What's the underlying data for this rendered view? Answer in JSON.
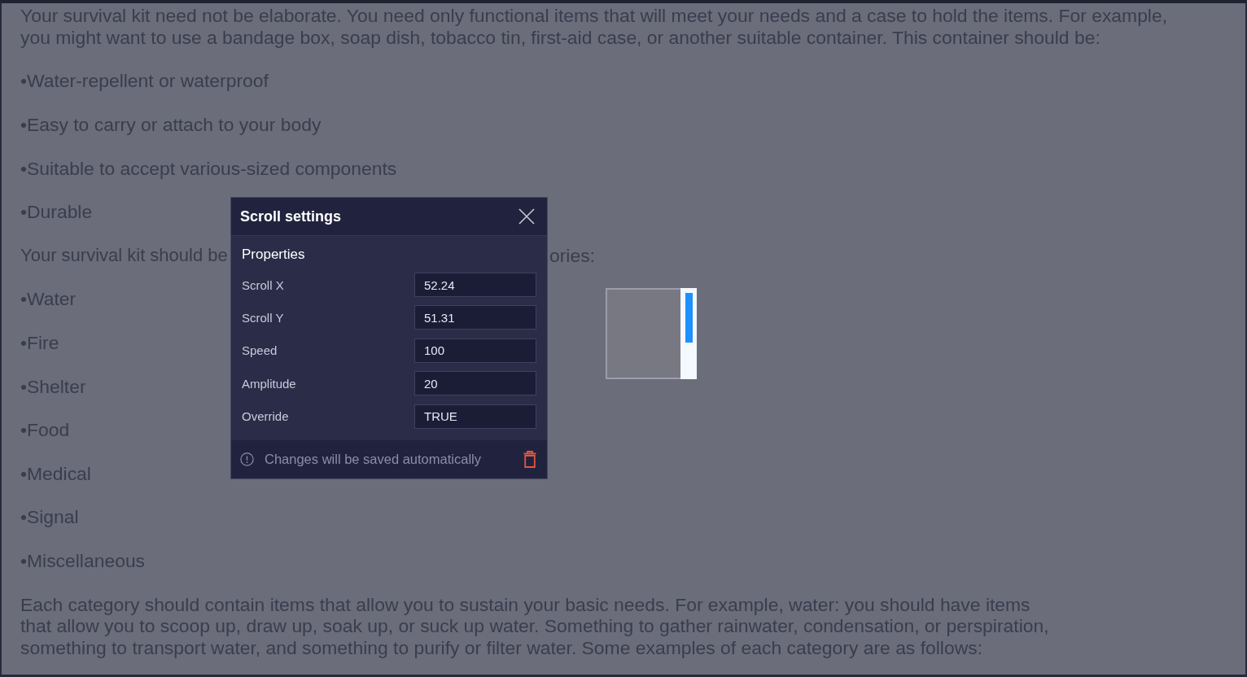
{
  "page": {
    "blocks": [
      {
        "kind": "paragraph",
        "text": "Your survival kit need not be elaborate. You need only functional items that will meet your needs and a case to hold the items. For example, you might want to use a bandage box, soap dish, tobacco tin, first-aid case, or another suitable container. This container should be:"
      },
      {
        "kind": "bullet",
        "text": "•Water-repellent or waterproof"
      },
      {
        "kind": "bullet",
        "text": "•Easy to carry or attach to your body"
      },
      {
        "kind": "bullet",
        "text": "•Suitable to accept various-sized components"
      },
      {
        "kind": "bullet",
        "text": "•Durable"
      },
      {
        "kind": "covered",
        "left": "Your survival kit should be",
        "right": "ories:"
      },
      {
        "kind": "bullet",
        "text": "•Water"
      },
      {
        "kind": "bullet",
        "text": "•Fire"
      },
      {
        "kind": "bullet",
        "text": "•Shelter"
      },
      {
        "kind": "bullet",
        "text": "•Food"
      },
      {
        "kind": "bullet",
        "text": "•Medical"
      },
      {
        "kind": "bullet",
        "text": "•Signal"
      },
      {
        "kind": "bullet",
        "text": "•Miscellaneous"
      },
      {
        "kind": "paragraph",
        "text": "Each category should contain items that allow you to sustain your basic needs. For example, water: you should have items that allow you to scoop up, draw up, soak up, or suck up water. Something to gather rainwater, condensation, or perspiration, something to transport water, and something to purify or filter water. Some examples of each category are as follows:"
      }
    ]
  },
  "dialog": {
    "title": "Scroll settings",
    "section": "Properties",
    "fields": [
      {
        "label": "Scroll X",
        "value": "52.24"
      },
      {
        "label": "Scroll Y",
        "value": "51.31"
      },
      {
        "label": "Speed",
        "value": "100"
      },
      {
        "label": "Amplitude",
        "value": "20"
      },
      {
        "label": "Override",
        "value": "TRUE"
      }
    ],
    "footer_note": "Changes will be saved automatically"
  }
}
